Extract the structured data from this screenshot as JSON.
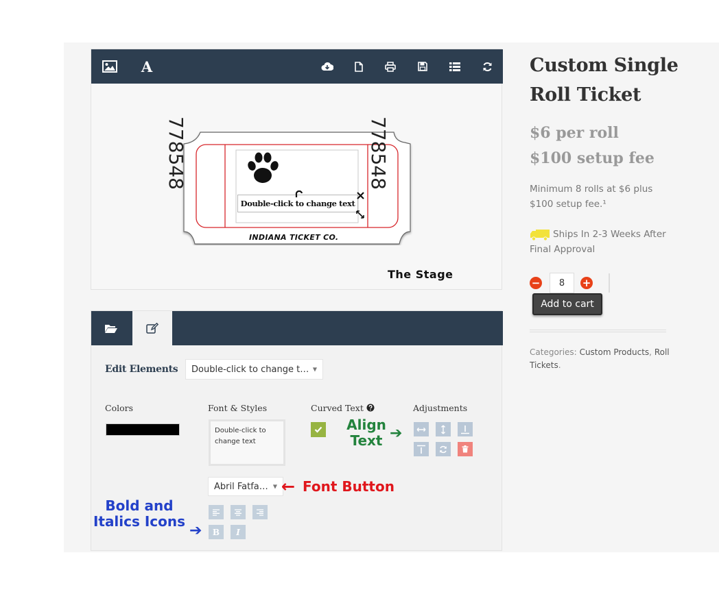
{
  "stage": {
    "label": "The Stage",
    "ticket": {
      "number_left": "778548",
      "number_right": "778548",
      "company": "INDIANA TICKET CO.",
      "text_element": "Double-click to change text"
    }
  },
  "editor": {
    "edit_elements_label": "Edit Elements",
    "element_select_value": "Double-click to change t…",
    "colors_label": "Colors",
    "color_value": "#000000",
    "font_styles_label": "Font & Styles",
    "textarea_value": "Double-click to change text",
    "curved_text_label": "Curved Text",
    "adjustments_label": "Adjustments",
    "font_select_value": "Abril Fatfa…"
  },
  "annotations": {
    "align_text_line1": "Align",
    "align_text_line2": "Text",
    "font_button": "Font Button",
    "bold_italics_line1": "Bold and",
    "bold_italics_line2": "Italics Icons",
    "arrow_right": "➔",
    "arrow_left": "←"
  },
  "product": {
    "title": "Custom Single Roll Ticket",
    "price_line": "$6 per roll",
    "setup_fee": "$100 setup fee",
    "minimum": "Minimum 8 rolls at $6 plus $100 setup fee.¹",
    "shipping": "Ships In 2-3 Weeks After Final Approval",
    "quantity": "8",
    "minus": "−",
    "plus": "+",
    "add_to_cart": "Add to cart",
    "categories_label": "Categories:",
    "category_1": "Custom Products",
    "category_sep": ",",
    "category_2": "Roll Tickets",
    "category_end": "."
  },
  "colors": {
    "toolbar": "#2d3e50",
    "accent_green": "#97b442",
    "delete_red": "#f0837d",
    "icon_blue_gray": "#b9c7d6"
  }
}
